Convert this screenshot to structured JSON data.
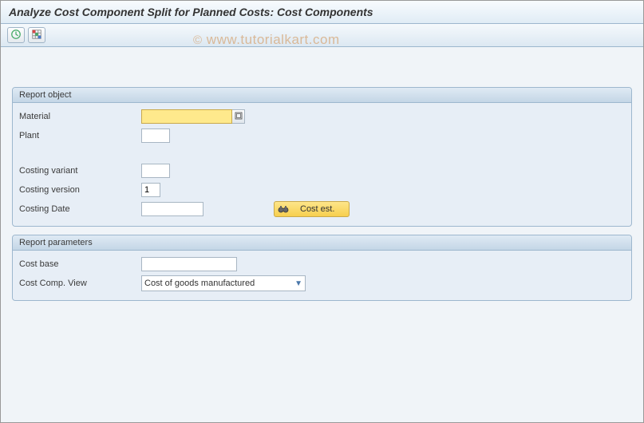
{
  "title": "Analyze Cost Component Split for Planned Costs: Cost Components",
  "watermark": "www.tutorialkart.com",
  "toolbar": {
    "execute_icon": "clock-execute",
    "grid_icon": "grid"
  },
  "group1": {
    "header": "Report object",
    "material_label": "Material",
    "material_value": "",
    "plant_label": "Plant",
    "plant_value": "",
    "costing_variant_label": "Costing variant",
    "costing_variant_value": "",
    "costing_version_label": "Costing version",
    "costing_version_value": "1",
    "costing_date_label": "Costing Date",
    "costing_date_value": "",
    "cost_est_button": "Cost est."
  },
  "group2": {
    "header": "Report parameters",
    "cost_base_label": "Cost base",
    "cost_base_value": "",
    "cost_comp_view_label": "Cost Comp. View",
    "cost_comp_view_value": "Cost of goods manufactured"
  }
}
